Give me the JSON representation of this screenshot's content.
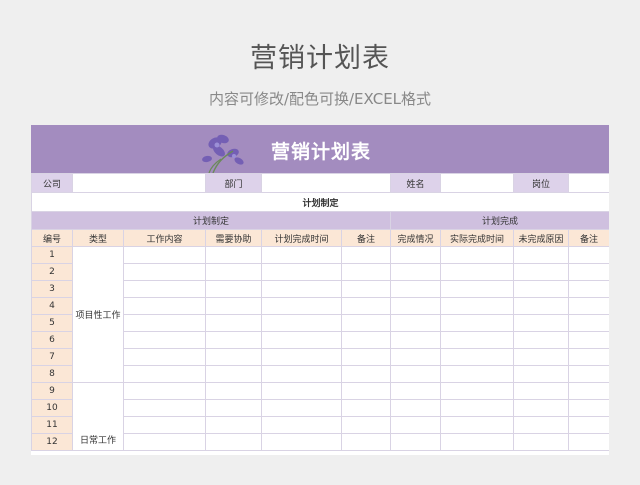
{
  "page": {
    "title": "营销计划表",
    "subtitle": "内容可修改/配色可换/EXCEL格式"
  },
  "banner": {
    "title": "营销计划表",
    "image": "purple-flower-illustration"
  },
  "info_row": {
    "company_label": "公司",
    "department_label": "部门",
    "name_label": "姓名",
    "position_label": "岗位"
  },
  "section_title": "计划制定",
  "groups": {
    "plan": "计划制定",
    "completion": "计划完成"
  },
  "columns": [
    "编号",
    "类型",
    "工作内容",
    "需要协助",
    "计划完成时间",
    "备注",
    "完成情况",
    "实际完成时间",
    "未完成原因",
    "备注"
  ],
  "types": {
    "project": "项目性工作",
    "daily": "日常工作"
  },
  "rows": [
    "1",
    "2",
    "3",
    "4",
    "5",
    "6",
    "7",
    "8",
    "9",
    "10",
    "11",
    "12"
  ],
  "colors": {
    "banner": "#a38cbf",
    "label_bg": "#ddd2ea",
    "header_bg": "#fbe7d6",
    "group_bg": "#cfc0df",
    "accent_text": "#5b3d86"
  }
}
